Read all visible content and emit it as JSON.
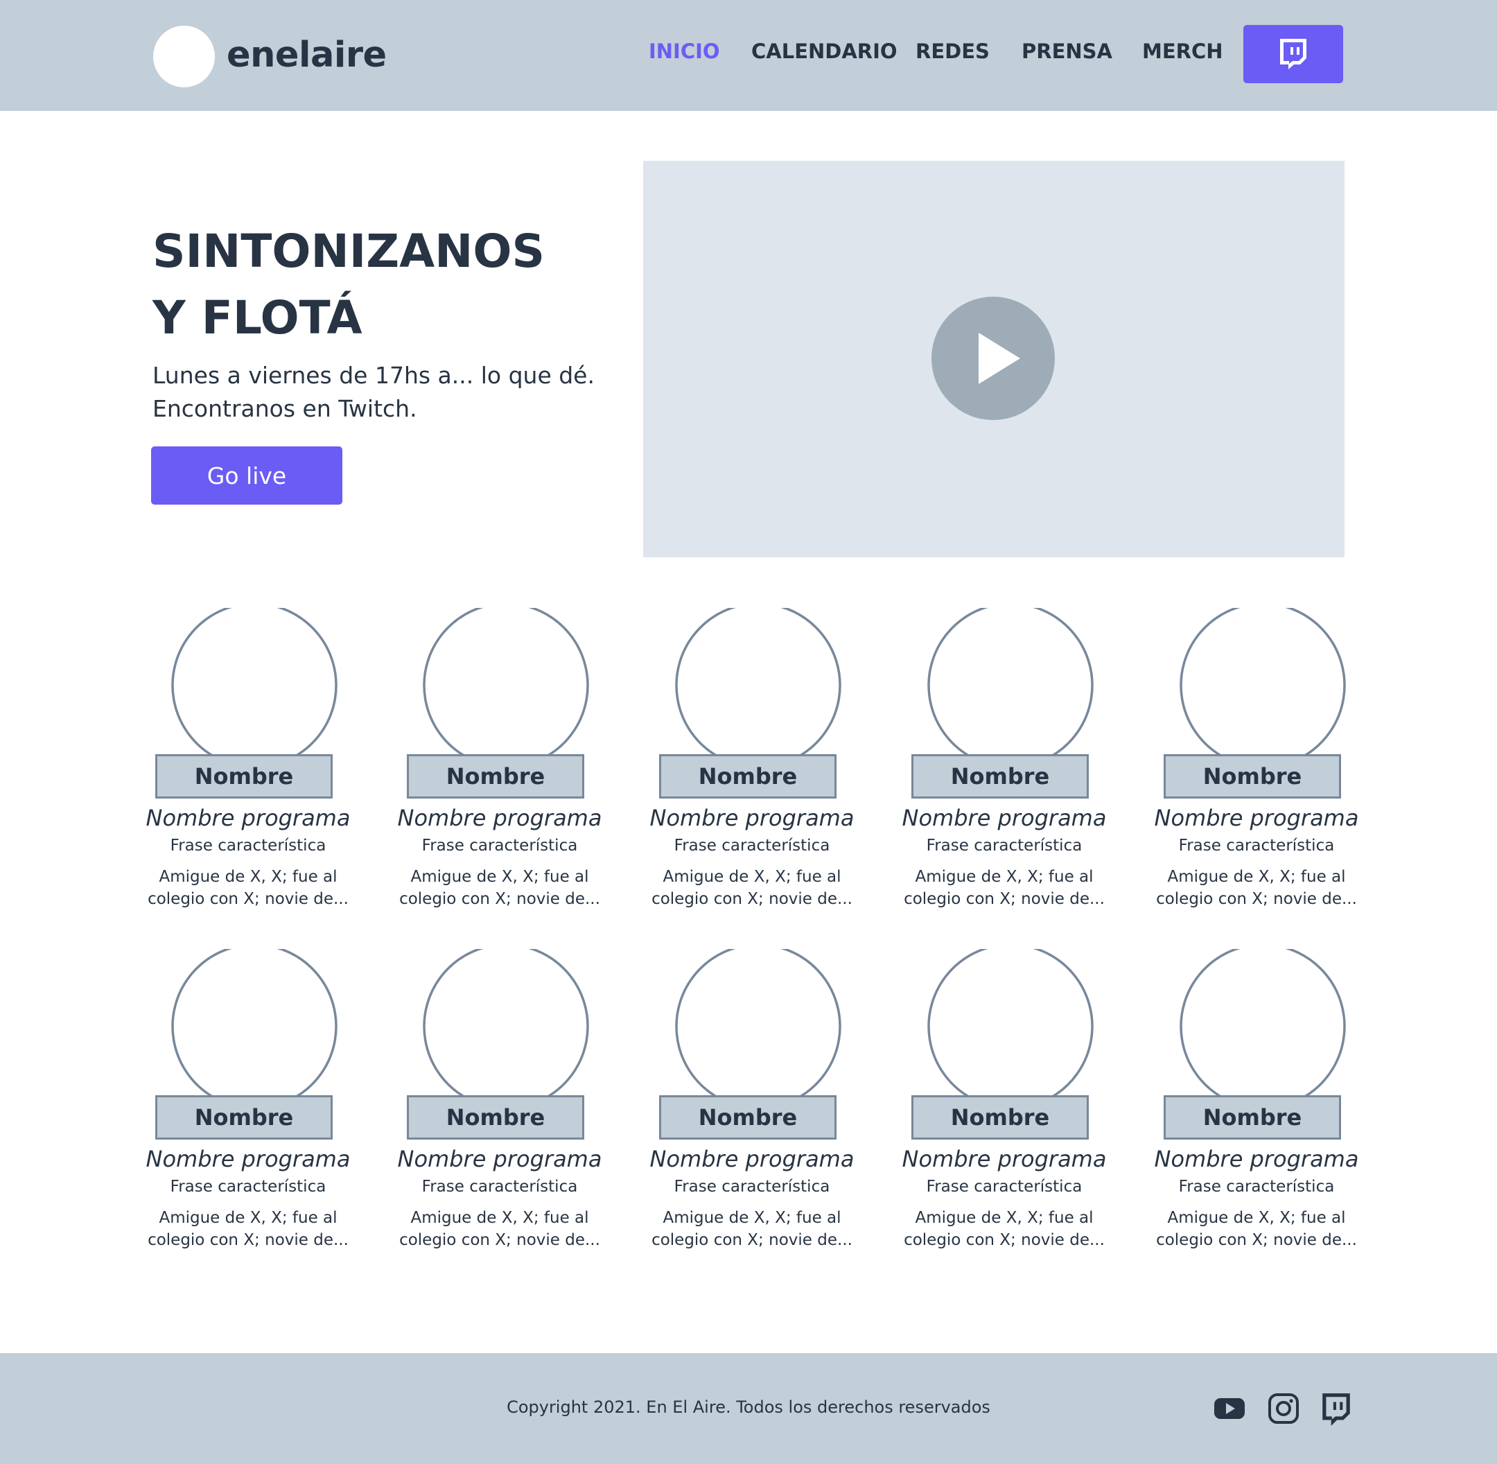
{
  "header": {
    "brand": "enelaire",
    "nav": [
      {
        "label": "INICIO",
        "active": true
      },
      {
        "label": "CALENDARIO",
        "active": false
      },
      {
        "label": "REDES",
        "active": false
      },
      {
        "label": "PRENSA",
        "active": false
      },
      {
        "label": "MERCH",
        "active": false
      }
    ],
    "cta_icon": "twitch-icon"
  },
  "hero": {
    "title_line1": "SINTONIZANOS",
    "title_line2": "Y FLOTÁ",
    "subtitle_line1": "Lunes a viernes de 17hs a... lo que dé.",
    "subtitle_line2": "Encontranos en Twitch.",
    "button_label": "Go live",
    "video_icon": "play-icon"
  },
  "cards": [
    {
      "name": "Nombre",
      "program": "Nombre programa",
      "phrase": "Frase característica",
      "bio_line1": "Amigue de X, X; fue al",
      "bio_line2": "colegio con X; novie de..."
    },
    {
      "name": "Nombre",
      "program": "Nombre programa",
      "phrase": "Frase característica",
      "bio_line1": "Amigue de X, X; fue al",
      "bio_line2": "colegio con X; novie de..."
    },
    {
      "name": "Nombre",
      "program": "Nombre programa",
      "phrase": "Frase característica",
      "bio_line1": "Amigue de X, X; fue al",
      "bio_line2": "colegio con X; novie de..."
    },
    {
      "name": "Nombre",
      "program": "Nombre programa",
      "phrase": "Frase característica",
      "bio_line1": "Amigue de X, X; fue al",
      "bio_line2": "colegio con X; novie de..."
    },
    {
      "name": "Nombre",
      "program": "Nombre programa",
      "phrase": "Frase característica",
      "bio_line1": "Amigue de X, X; fue al",
      "bio_line2": "colegio con X; novie de..."
    },
    {
      "name": "Nombre",
      "program": "Nombre programa",
      "phrase": "Frase característica",
      "bio_line1": "Amigue de X, X; fue al",
      "bio_line2": "colegio con X; novie de..."
    },
    {
      "name": "Nombre",
      "program": "Nombre programa",
      "phrase": "Frase característica",
      "bio_line1": "Amigue de X, X; fue al",
      "bio_line2": "colegio con X; novie de..."
    },
    {
      "name": "Nombre",
      "program": "Nombre programa",
      "phrase": "Frase característica",
      "bio_line1": "Amigue de X, X; fue al",
      "bio_line2": "colegio con X; novie de..."
    },
    {
      "name": "Nombre",
      "program": "Nombre programa",
      "phrase": "Frase característica",
      "bio_line1": "Amigue de X, X; fue al",
      "bio_line2": "colegio con X; novie de..."
    },
    {
      "name": "Nombre",
      "program": "Nombre programa",
      "phrase": "Frase característica",
      "bio_line1": "Amigue de X, X; fue al",
      "bio_line2": "colegio con X; novie de..."
    }
  ],
  "footer": {
    "copyright": "Copyright 2021. En El Aire. Todos los derechos reservados",
    "social_icons": [
      "youtube-icon",
      "instagram-icon",
      "twitch-icon"
    ]
  },
  "colors": {
    "accent": "#6b5cf5",
    "header_bg": "#c2ced8",
    "text": "#283443",
    "video_bg": "#dfe5ed",
    "outline": "#78889a"
  }
}
